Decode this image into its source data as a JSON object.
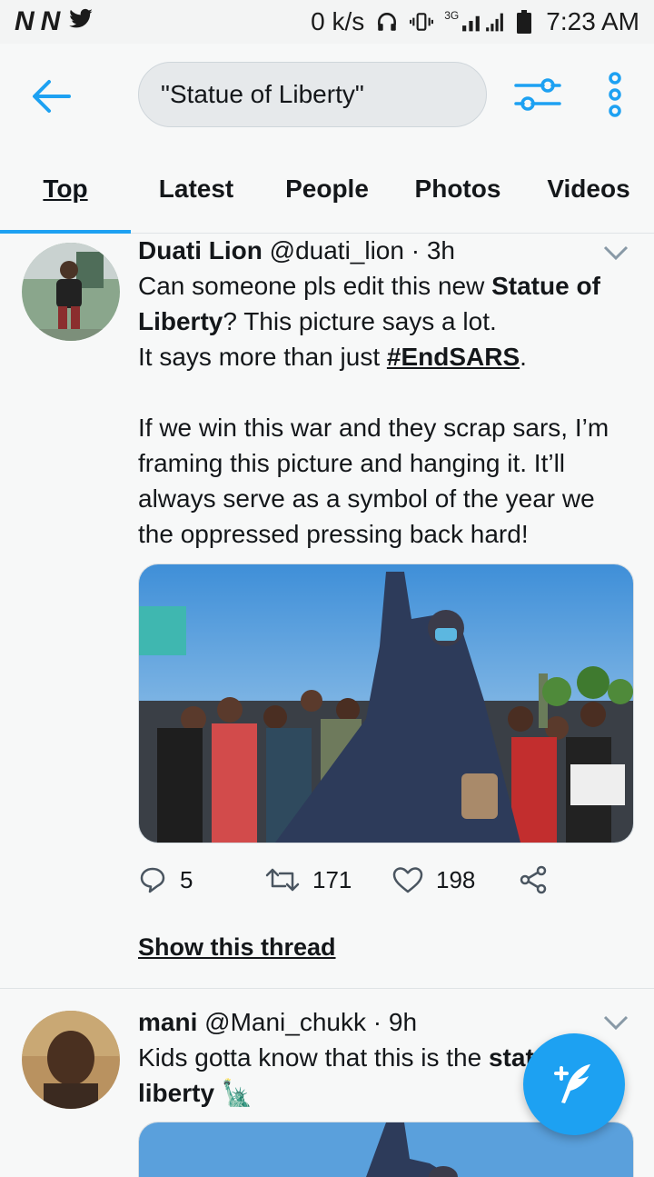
{
  "status_bar": {
    "left_icons": [
      "N",
      "N"
    ],
    "network_speed": "0 k/s",
    "network_type": "3G",
    "time": "7:23 AM",
    "icons": [
      "headphones-icon",
      "vibrate-icon",
      "signal-icon",
      "battery-icon"
    ]
  },
  "appbar": {
    "search_value": "\"Statue of Liberty\"",
    "accent": "#1da1f2"
  },
  "tabs": [
    {
      "label": "Top",
      "active": true
    },
    {
      "label": "Latest",
      "active": false
    },
    {
      "label": "People",
      "active": false
    },
    {
      "label": "Photos",
      "active": false
    },
    {
      "label": "Videos",
      "active": false
    }
  ],
  "tweets": [
    {
      "name": "Duati Lion",
      "handle": "@duati_lion",
      "time": "· 3h",
      "text_parts": {
        "p1": "Can someone pls edit this new ",
        "bold": "Statue of Liberty",
        "p2": "? This picture says a lot.",
        "p3": "It says more than just ",
        "tag": "#EndSARS",
        "p4": ".",
        "p5": "If we win this war and they scrap sars, I’m framing this picture and hanging it. It’ll always serve as a symbol of the year we the oppressed pressing back hard!"
      },
      "replies": "5",
      "retweets": "171",
      "likes": "198",
      "show_thread": "Show this thread"
    },
    {
      "name": "mani",
      "handle": "@Mani_chukk",
      "time": "· 9h",
      "text_parts": {
        "p1": "Kids gotta know that this is the ",
        "bold": "statue of",
        "bold2": "liberty",
        "emoji": "🗽"
      }
    }
  ]
}
